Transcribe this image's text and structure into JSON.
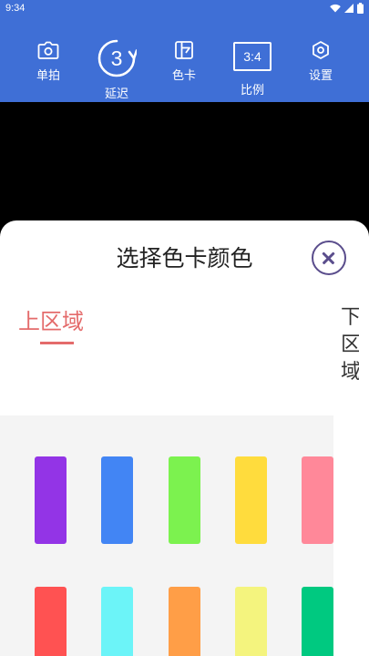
{
  "status_bar": {
    "time": "9:34"
  },
  "toolbar": {
    "single_label": "单拍",
    "delay_label": "延迟",
    "delay_value": "3",
    "card_label": "色卡",
    "ratio_label": "比例",
    "ratio_value": "3:4",
    "settings_label": "设置"
  },
  "sheet": {
    "title": "选择色卡颜色",
    "tabs": [
      {
        "label": "上区域",
        "selected": true
      },
      {
        "label": "下区域",
        "selected": false
      }
    ],
    "colors": [
      [
        "#9334e6",
        "#4285f4",
        "#7cf24f",
        "#ffdc3d",
        "#ff8899"
      ],
      [
        "#ff5252",
        "#6cf4f8",
        "#ff9e47",
        "#f4f47e",
        "#00c980"
      ]
    ]
  },
  "accent_color": "#3f6fd6",
  "selected_tab_color": "#e46b6b"
}
